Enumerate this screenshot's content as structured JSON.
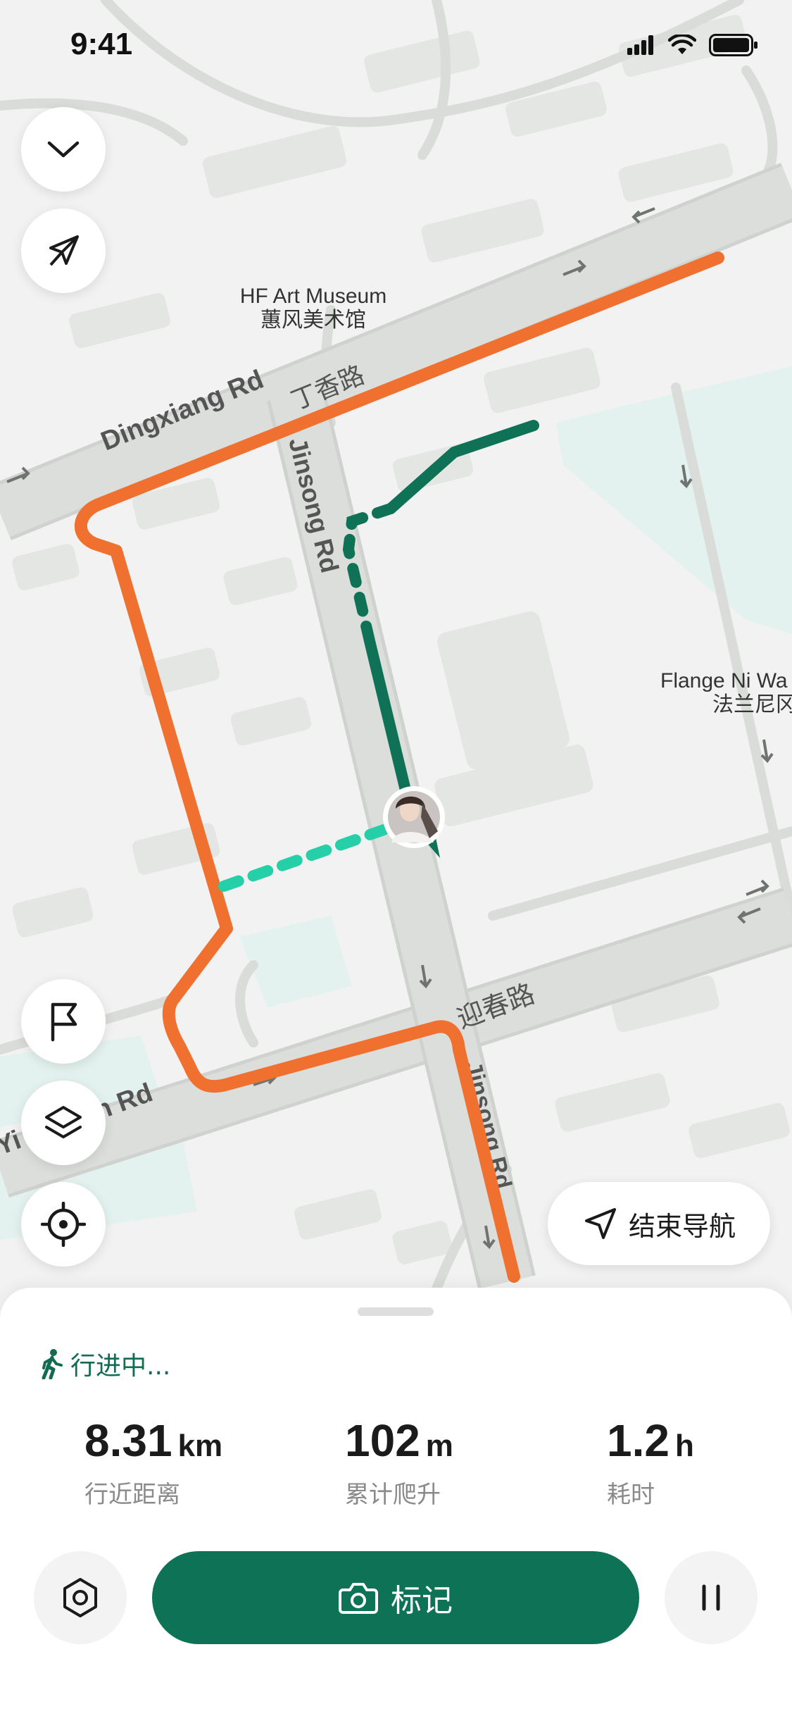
{
  "status_bar": {
    "time": "9:41"
  },
  "map": {
    "poi_museum_en": "HF Art Museum",
    "poi_museum_zh": "蕙风美术馆",
    "road_dingxiang_en": "Dingxiang Rd",
    "road_dingxiang_zh": "丁香路",
    "road_jinsong": "Jinsong Rd",
    "road_yingchun_zh": "迎春路",
    "road_yingchun_en_part1": "Yi",
    "road_yingchun_en_part2": "n Rd",
    "road_jinsong_lower": "Jinsong Rd",
    "poi_flange_en": "Flange Ni Wa",
    "poi_flange_zh": "法兰尼冈",
    "colors": {
      "route_planned": "#f07030",
      "route_walked": "#0f7257",
      "route_connector": "#25cfa8"
    }
  },
  "controls": {
    "collapse_icon": "chevron-down-icon",
    "compass_icon": "compass-icon",
    "flag_icon": "flag-icon",
    "layers_icon": "layers-icon",
    "locate_icon": "crosshair-icon",
    "end_navigation_label": "结束导航",
    "end_navigation_icon": "navigation-arrow-icon"
  },
  "sheet": {
    "status_text": "行进中...",
    "stats": [
      {
        "value": "8.31",
        "unit": "km",
        "label": "行近距离"
      },
      {
        "value": "102",
        "unit": "m",
        "label": "累计爬升"
      },
      {
        "value": "1.2",
        "unit": "h",
        "label": "耗时"
      }
    ],
    "mark_button_label": "标记",
    "accent_color": "#0e7256"
  }
}
